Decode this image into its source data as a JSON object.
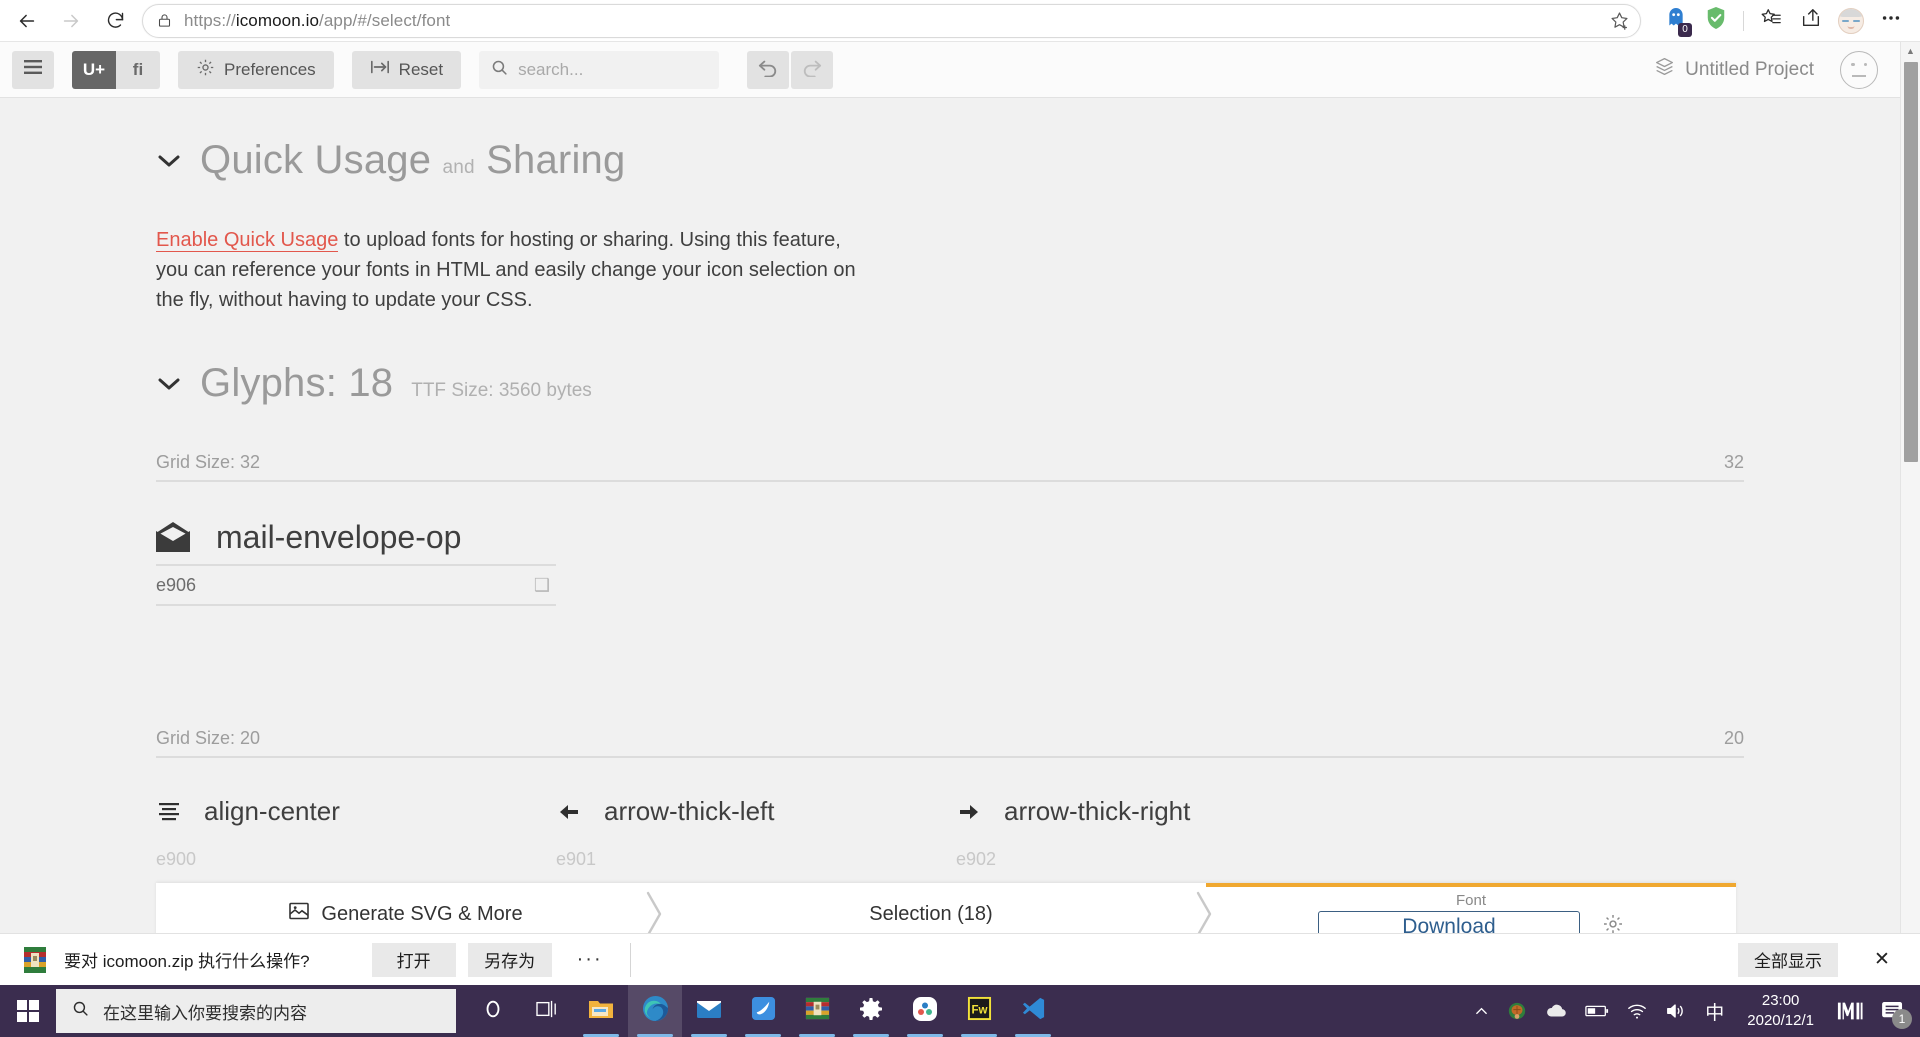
{
  "browser": {
    "back_icon": "back-arrow-icon",
    "forward_icon": "forward-arrow-icon",
    "reload_icon": "reload-icon",
    "lock_icon": "lock-icon",
    "url_prefix": "https://",
    "url_domain": "icomoon.io",
    "url_path": "/app/#/select/font",
    "url_full": "https://icomoon.io/app/#/select/font",
    "star_icon": "add-favorite-star-icon",
    "extensions": [
      {
        "name": "ghost-extension-icon",
        "badge": "0"
      },
      {
        "name": "adblock-shield-icon",
        "badge": ""
      }
    ],
    "collections_icon": "collections-icon",
    "share_icon": "share-icon",
    "profile_icon": "profile-avatar-icon",
    "settings_icon": "more-options-icon"
  },
  "app_toolbar": {
    "menu_label": "≡",
    "menu_icon": "hamburger-menu-icon",
    "seg_unicode": "U+",
    "seg_ligature": "fi",
    "preferences_label": "Preferences",
    "preferences_icon": "gear-icon",
    "reset_label": "Reset",
    "reset_icon": "reset-icon",
    "search_placeholder": "search...",
    "search_value": "",
    "search_icon": "search-icon",
    "undo_icon": "undo-arrow-icon",
    "redo_icon": "redo-arrow-icon",
    "project_name": "Untitled Project",
    "project_icon": "layers-icon",
    "account_icon": "neutral-face-icon"
  },
  "quick_usage": {
    "chevron": "⌄",
    "title": "Quick Usage",
    "title_conjunction": "and",
    "title_second": "Sharing",
    "link_text": "Enable Quick Usage",
    "body_text": " to upload fonts for hosting or sharing. Using this feature, you can reference your fonts in HTML and easily change your icon selection on the fly, without having to update your CSS."
  },
  "glyphs_section": {
    "chevron": "⌄",
    "title": "Glyphs: 18",
    "ttf_size": "TTF Size: 3560 bytes",
    "grid32_label": "Grid Size: 32",
    "grid32_value": "32",
    "grid20_label": "Grid Size: 20",
    "grid20_value": "20",
    "glyphs_32": [
      {
        "icon": "mail-envelope-open-icon",
        "name": "mail-envelope-op",
        "code": "e906",
        "preview": "❑"
      }
    ],
    "glyphs_20": [
      {
        "icon": "align-center-icon",
        "name": "align-center",
        "code": "e900",
        "preview": "❑"
      },
      {
        "icon": "arrow-thick-left-icon",
        "name": "arrow-thick-left",
        "code": "e901",
        "preview": "❑"
      },
      {
        "icon": "arrow-thick-right-icon",
        "name": "arrow-thick-right",
        "code": "e902",
        "preview": "❑"
      }
    ]
  },
  "bottom_bar": {
    "generate_label": "Generate SVG & More",
    "generate_icon": "image-icon",
    "selection_label": "Selection (18)",
    "font_label": "Font",
    "download_label": "Download",
    "settings_icon": "gear-icon",
    "accent_color": "#f0a830"
  },
  "download_notification": {
    "file_icon": "winrar-zip-icon",
    "message": "要对 icomoon.zip 执行什么操作?",
    "open_label": "打开",
    "saveas_label": "另存为",
    "more_label": "···",
    "showall_label": "全部显示",
    "close_label": "✕"
  },
  "taskbar": {
    "start_icon": "windows-start-icon",
    "search_icon": "search-icon",
    "search_placeholder": "在这里输入你要搜索的内容",
    "apps": [
      {
        "name": "cortana-icon",
        "running": false
      },
      {
        "name": "task-view-icon",
        "running": false
      },
      {
        "name": "file-explorer-icon",
        "running": true
      },
      {
        "name": "microsoft-edge-icon",
        "running": true
      },
      {
        "name": "mail-icon",
        "running": true
      },
      {
        "name": "foxmail-icon",
        "running": true
      },
      {
        "name": "winrar-icon",
        "running": true
      },
      {
        "name": "settings-gear-icon",
        "running": true
      },
      {
        "name": "chrome-like-app-icon",
        "running": true
      },
      {
        "name": "fireworks-icon",
        "running": true
      },
      {
        "name": "vscode-icon",
        "running": true
      }
    ],
    "tray": [
      {
        "name": "show-hidden-icons-chevron"
      },
      {
        "name": "tortoise-app-icon"
      },
      {
        "name": "onedrive-cloud-icon"
      },
      {
        "name": "battery-icon"
      },
      {
        "name": "wifi-icon"
      },
      {
        "name": "volume-icon"
      },
      {
        "name": "ime-chinese-icon",
        "label": "中"
      }
    ],
    "clock_time": "23:00",
    "clock_date": "2020/12/1",
    "extra_icons": [
      {
        "name": "mi-app-icon"
      },
      {
        "name": "action-center-icon",
        "badge": "1"
      }
    ]
  }
}
